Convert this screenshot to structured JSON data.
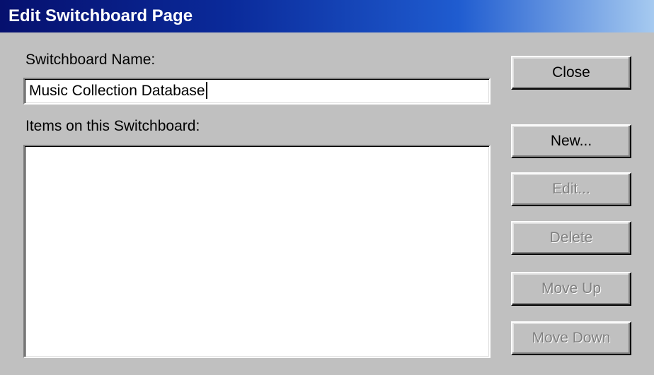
{
  "window": {
    "title": "Edit Switchboard Page"
  },
  "form": {
    "name_label": "Switchboard Name:",
    "name_value": "Music Collection Database",
    "items_label": "Items on this Switchboard:",
    "items": []
  },
  "buttons": {
    "close": "Close",
    "new": "New...",
    "edit": "Edit...",
    "delete": "Delete",
    "move_up": "Move Up",
    "move_down": "Move Down"
  },
  "colors": {
    "dialog_bg": "#c0c0c0",
    "title_gradient_start": "#06106e",
    "title_gradient_end": "#a6caf0",
    "disabled_text": "#808080"
  }
}
